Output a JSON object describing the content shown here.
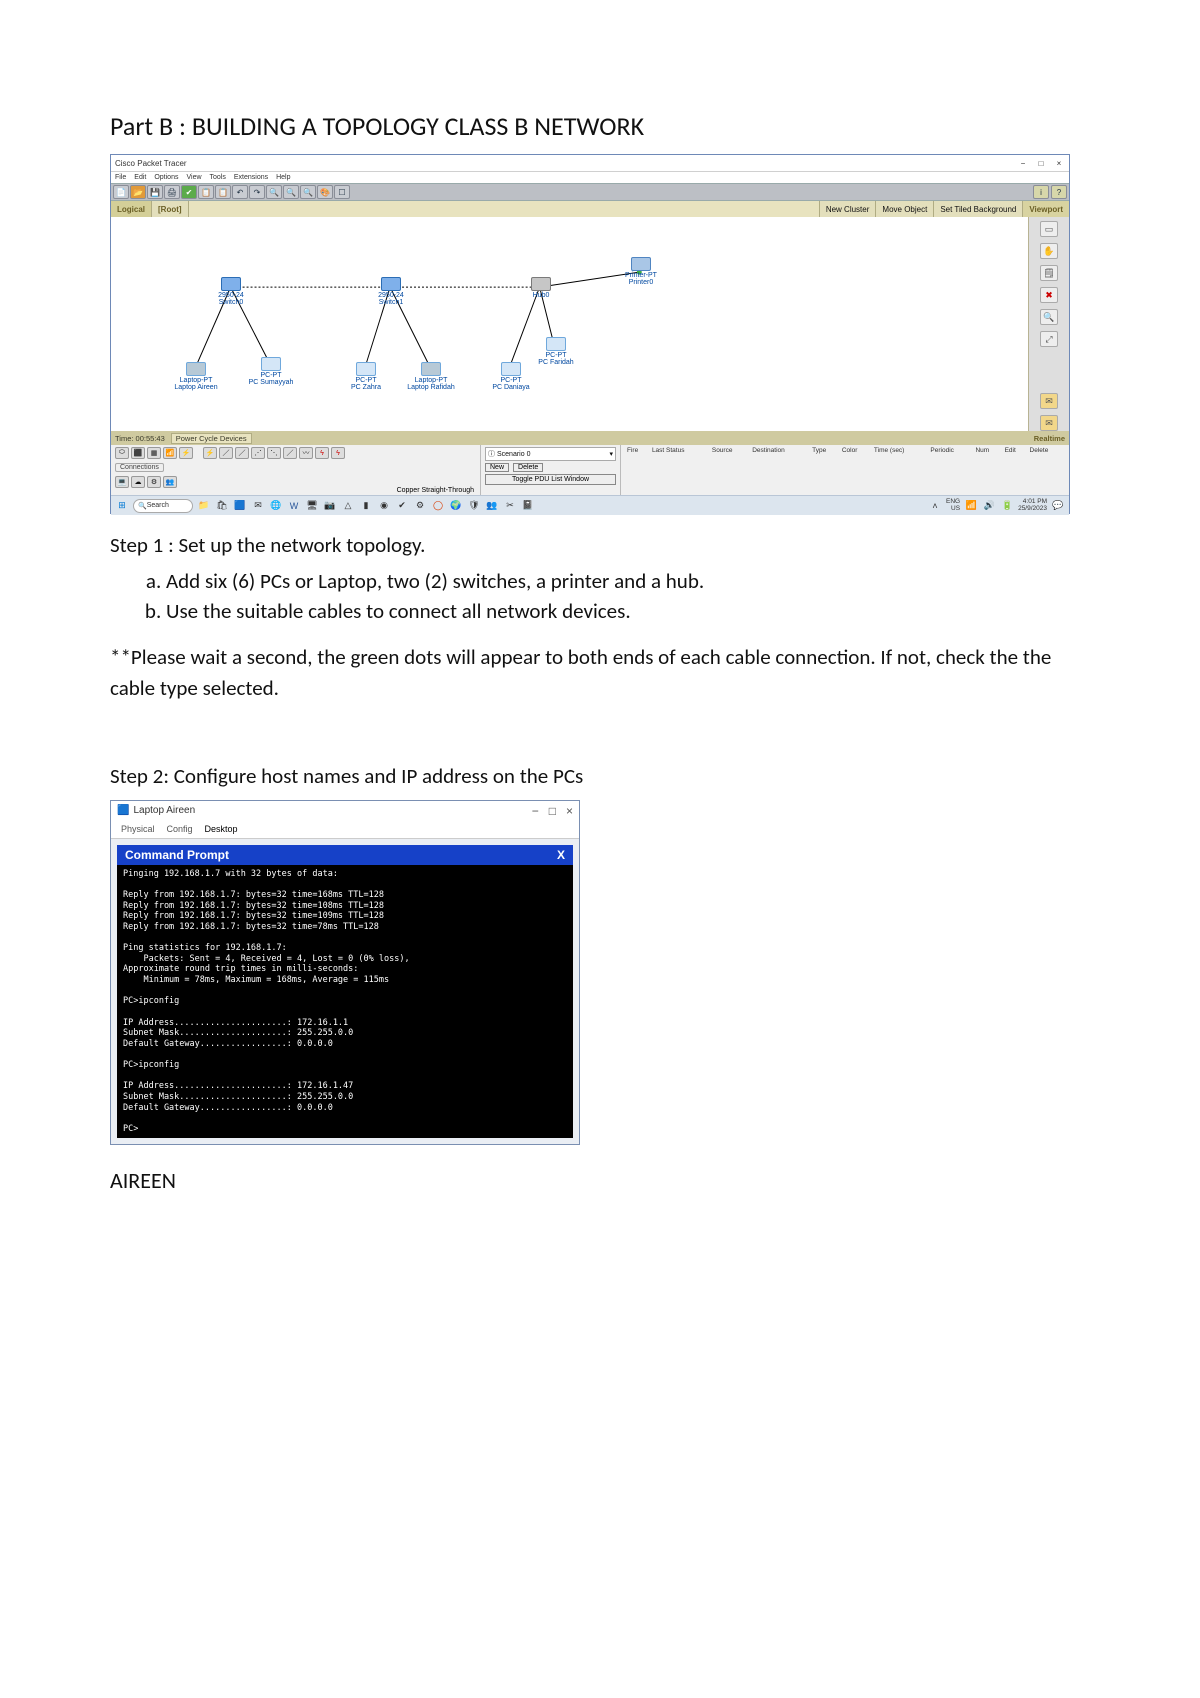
{
  "doc": {
    "part_title": "Part B : BUILDING A TOPOLOGY CLASS B NETWORK",
    "step1": "Step 1 : Set up the network topology.",
    "step1a": "Add six (6) PCs or Laptop, two (2) switches, a printer and a hub.",
    "step1b": "Use the suitable cables to connect all network devices.",
    "note": "**Please wait a second, the green dots will appear to both ends of each cable connection. If not, check the the cable type selected.",
    "step2": "Step 2: Configure host names and IP address on the PCs",
    "aireen": "AIREEN"
  },
  "pt": {
    "app_title": "Cisco Packet Tracer",
    "menu": [
      "File",
      "Edit",
      "Options",
      "View",
      "Tools",
      "Extensions",
      "Help"
    ],
    "ribbon": {
      "logical": "Logical",
      "root": "[Root]",
      "new_cluster": "New Cluster",
      "move_obj": "Move Object",
      "set_bg": "Set Tiled Background",
      "viewport": "Viewport"
    },
    "status": {
      "time": "Time: 00:55:43",
      "pcd": "Power Cycle Devices",
      "realtime": "Realtime"
    },
    "bottom": {
      "connections_tab": "Connections",
      "copper": "Copper Straight-Through"
    },
    "scenario": {
      "label": "Scenario 0",
      "new": "New",
      "delete": "Delete",
      "toggle": "Toggle PDU List Window"
    },
    "events": {
      "cols": [
        "Fire",
        "Last Status",
        "Source",
        "Destination",
        "Type",
        "Color",
        "Time (sec)",
        "Periodic",
        "Num",
        "Edit",
        "Delete"
      ]
    },
    "win_minimize": "−",
    "win_close": "×",
    "win_max": "□"
  },
  "topology": {
    "switch0": {
      "name": "2950-24",
      "sub": "Switch0"
    },
    "switch1": {
      "name": "2950-24",
      "sub": "Switch1"
    },
    "hub": {
      "name": "Hub0"
    },
    "printer": {
      "name": "Printer-PT",
      "sub": "Printer0"
    },
    "laptop_aireen": {
      "name": "Laptop-PT",
      "sub": "Laptop Aireen"
    },
    "pc_sumayyah": {
      "name": "PC-PT",
      "sub": "PC Sumayyah"
    },
    "pc_zahra": {
      "name": "PC-PT",
      "sub": "PC Zahra"
    },
    "laptop_rafidah": {
      "name": "Laptop-PT",
      "sub": "Laptop Rafidah"
    },
    "pc_daniaya": {
      "name": "PC-PT",
      "sub": "PC Daniaya"
    },
    "pc_faridah": {
      "name": "PC-PT",
      "sub": "PC Faridah"
    }
  },
  "taskbar": {
    "search": "Search",
    "lang": "ENG",
    "kb": "US",
    "time": "4:01 PM",
    "date": "25/9/2023"
  },
  "cmd": {
    "title": "Laptop Aireen",
    "tabs": [
      "Physical",
      "Config",
      "Desktop"
    ],
    "header": "Command Prompt",
    "close": "X",
    "lines": [
      "Pinging 192.168.1.7 with 32 bytes of data:",
      "",
      "Reply from 192.168.1.7: bytes=32 time=168ms TTL=128",
      "Reply from 192.168.1.7: bytes=32 time=108ms TTL=128",
      "Reply from 192.168.1.7: bytes=32 time=109ms TTL=128",
      "Reply from 192.168.1.7: bytes=32 time=78ms TTL=128",
      "",
      "Ping statistics for 192.168.1.7:",
      "    Packets: Sent = 4, Received = 4, Lost = 0 (0% loss),",
      "Approximate round trip times in milli-seconds:",
      "    Minimum = 78ms, Maximum = 168ms, Average = 115ms",
      "",
      "PC>ipconfig",
      "",
      "IP Address......................: 172.16.1.1",
      "Subnet Mask.....................: 255.255.0.0",
      "Default Gateway.................: 0.0.0.0",
      "",
      "PC>ipconfig",
      "",
      "IP Address......................: 172.16.1.47",
      "Subnet Mask.....................: 255.255.0.0",
      "Default Gateway.................: 0.0.0.0",
      "",
      "PC>"
    ]
  }
}
